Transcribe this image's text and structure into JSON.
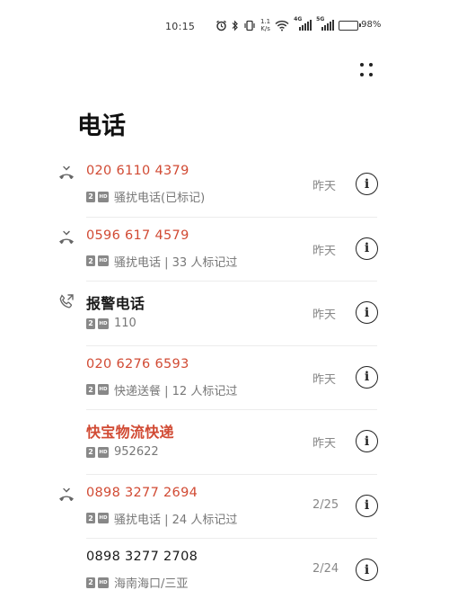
{
  "status_bar": {
    "time": "10:15",
    "alarm_icon": "alarm-icon",
    "bluetooth_icon": "bluetooth-icon",
    "vibrate_icon": "vibrate-icon",
    "net_speed_value": "1.1",
    "net_speed_unit": "K/s",
    "wifi_icon": "wifi-icon",
    "signal1_label": "4G",
    "signal2_label": "5G",
    "battery_percent": "98%",
    "battery_level": 0.98
  },
  "header": {
    "title": "电话",
    "more_icon": "more-icon"
  },
  "colors": {
    "missed": "#d14a33",
    "normal": "#1a1a1a",
    "subtext": "#777777"
  },
  "calls": [
    {
      "name": "020 6110 4379",
      "sub": "骚扰电话(已标记)",
      "date": "昨天",
      "type": "missed",
      "icon": "missed-call-icon"
    },
    {
      "name": "0596 617 4579",
      "sub": "骚扰电话 | 33 人标记过",
      "date": "昨天",
      "type": "missed",
      "icon": "missed-call-icon"
    },
    {
      "name": "报警电话",
      "sub": "110",
      "date": "昨天",
      "type": "outgoing",
      "icon": "outgoing-call-icon"
    },
    {
      "name": "020 6276 6593",
      "sub": "快递送餐 | 12 人标记过",
      "date": "昨天",
      "type": "missed",
      "icon": ""
    },
    {
      "name": "快宝物流快递",
      "sub": "952622",
      "date": "昨天",
      "type": "missed",
      "icon": ""
    },
    {
      "name": "0898 3277 2694",
      "sub": "骚扰电话 | 24 人标记过",
      "date": "2/25",
      "type": "missed",
      "icon": "missed-call-icon"
    },
    {
      "name": "0898 3277 2708",
      "sub": "海南海口/三亚",
      "date": "2/24",
      "type": "normal",
      "icon": ""
    }
  ],
  "badges": {
    "sim": "2",
    "hd": "HD"
  },
  "info_glyph": "i"
}
